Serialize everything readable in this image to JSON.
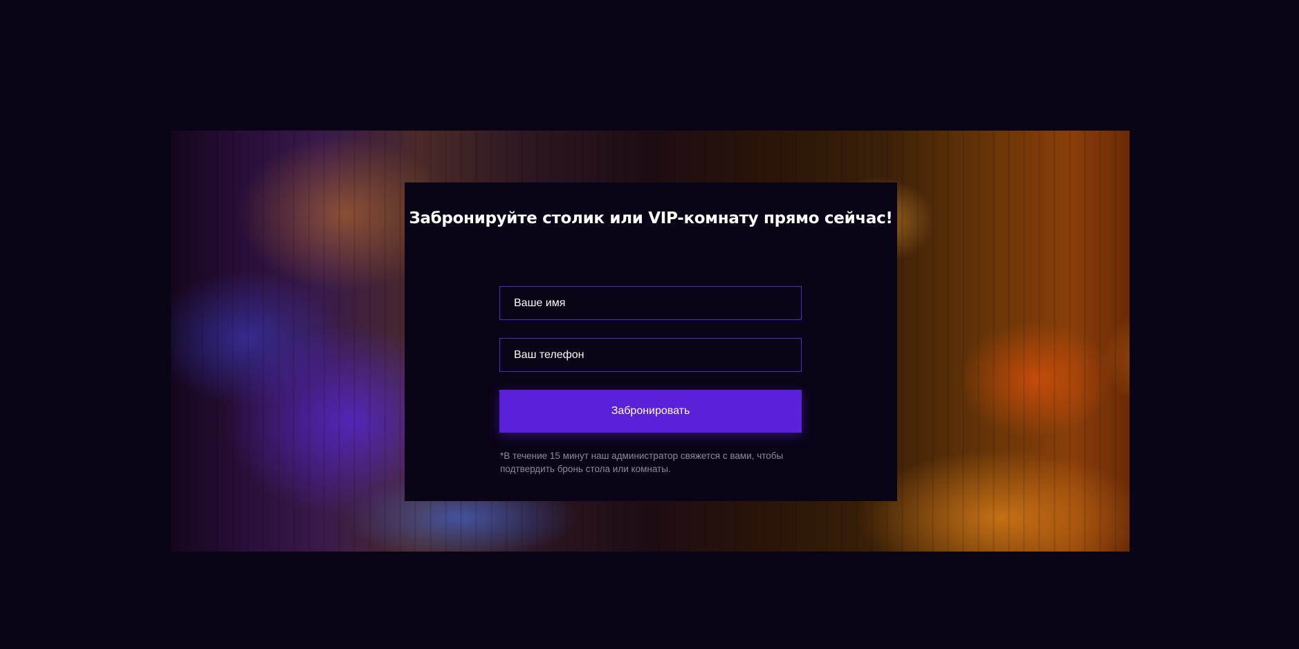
{
  "booking": {
    "title": "Забронируйте столик или VIP-комнату прямо сейчас!",
    "name_placeholder": "Ваше имя",
    "phone_placeholder": "Ваш телефон",
    "submit_label": "Забронировать",
    "note": "*В течение 15 минут наш администратор свяжется с вами, чтобы подтвердить бронь стола или комнаты."
  },
  "colors": {
    "background": "#0a0417",
    "accent": "#5b21d9",
    "field_border": "#4a2fc4",
    "note_text": "#8e8a99"
  }
}
